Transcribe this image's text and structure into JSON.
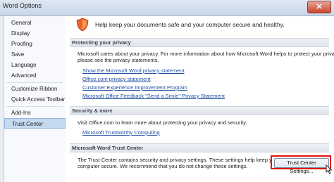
{
  "window": {
    "title": "Word Options",
    "close_label": "✕"
  },
  "sidebar": {
    "items": [
      {
        "label": "General"
      },
      {
        "label": "Display"
      },
      {
        "label": "Proofing"
      },
      {
        "label": "Save"
      },
      {
        "label": "Language"
      },
      {
        "label": "Advanced"
      },
      {
        "label": "Customize Ribbon"
      },
      {
        "label": "Quick Access Toolbar"
      },
      {
        "label": "Add-Ins"
      },
      {
        "label": "Trust Center"
      }
    ],
    "selected": "Trust Center"
  },
  "header": {
    "text": "Help keep your documents safe and your computer secure and healthy."
  },
  "privacy": {
    "heading": "Protecting your privacy",
    "line1": "Microsoft cares about your privacy. For more information about how Microsoft Word helps to protect your privacy,",
    "line2": "please see the privacy statements.",
    "links": [
      "Show the Microsoft Word privacy statement",
      "Office.com privacy statement",
      "Customer Experience Improvement Program",
      "Microsoft Office Feedback \"Send a Smile\" Privacy Statement"
    ]
  },
  "security": {
    "heading": "Security & more",
    "text": "Visit Office.com to learn more about protecting your privacy and security.",
    "link": "Microsoft Trustworthy Computing"
  },
  "trust_center": {
    "heading": "Microsoft Word Trust Center",
    "line1": "The Trust Center contains security and privacy settings. These settings help keep your",
    "line2": "computer secure. We recommend that you do not change these settings.",
    "button_label": "Trust Center Settings..."
  },
  "colors": {
    "accent_red": "#e0120f",
    "link": "#1f4fa3",
    "selection": "#c5d9f1"
  }
}
